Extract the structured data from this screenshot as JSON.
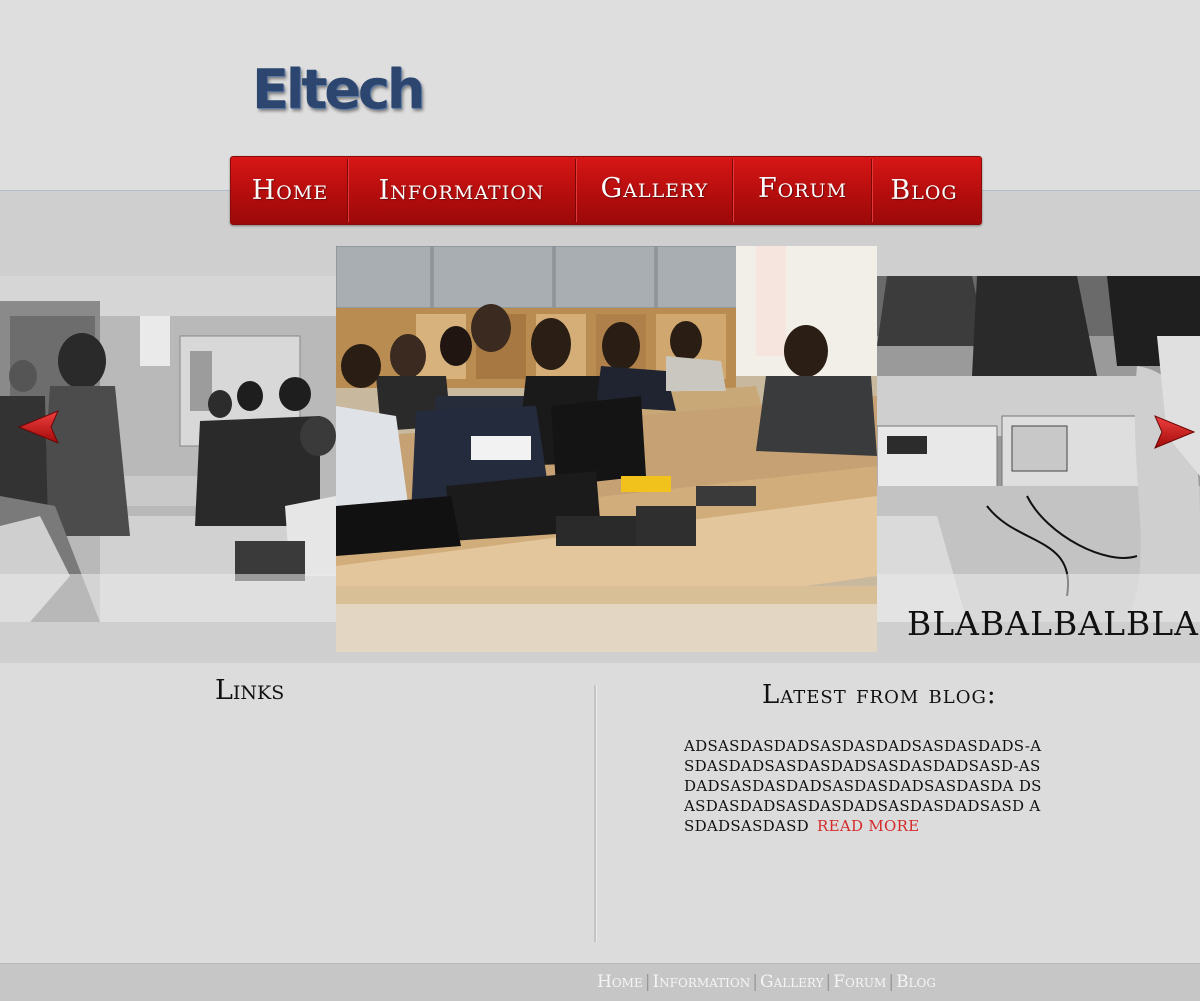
{
  "logo": {
    "text": "Eltech"
  },
  "nav": {
    "items": [
      {
        "label": "Home"
      },
      {
        "label": "Information"
      },
      {
        "label": "Gallery"
      },
      {
        "label": "Forum"
      },
      {
        "label": "Blog"
      }
    ]
  },
  "slider": {
    "caption": "BLABALBALBLA"
  },
  "links": {
    "title": "Links"
  },
  "blog": {
    "title": "Latest from blog:",
    "excerpt": "adsasdasdadsasdasdadsasdasdads-asdasdadsasdasdadsasdasdadsasd-asdadsasdasdadsasdasdadsasdasda dsasdasdadsasdasdadsasdasdadsasd asdadsasdasd",
    "read_more": "read more"
  },
  "footer": {
    "items": [
      {
        "label": "Home"
      },
      {
        "label": "Information"
      },
      {
        "label": "Gallery"
      },
      {
        "label": "Forum"
      },
      {
        "label": "Blog"
      }
    ]
  },
  "colors": {
    "nav_red": "#c41111",
    "logo_blue": "#2d4670",
    "read_more": "#d42a2a"
  }
}
